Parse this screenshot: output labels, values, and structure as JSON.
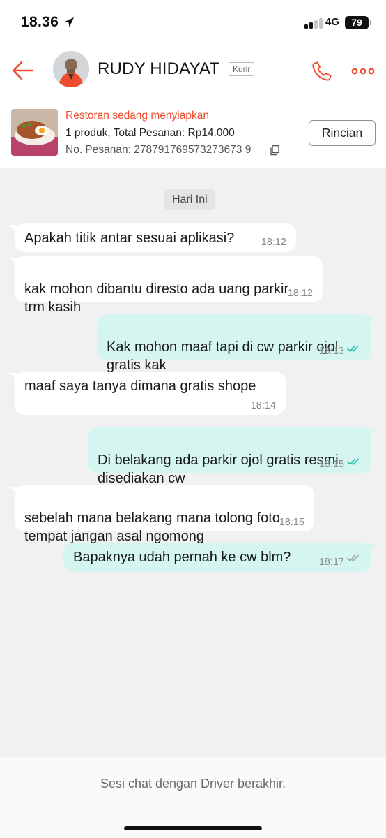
{
  "status_bar": {
    "time": "18.36",
    "network": "4G",
    "battery": "79"
  },
  "header": {
    "name": "RUDY HIDAYAT",
    "badge": "Kurir"
  },
  "order": {
    "status": "Restoran sedang menyiapkan",
    "summary": "1 produk, Total Pesanan: Rp14.000",
    "number": "No. Pesanan: 278791769573273673 9",
    "button": "Rincian"
  },
  "chat": {
    "date_label": "Hari Ini",
    "messages": [
      {
        "direction": "in",
        "text": "Apakah titik antar sesuai aplikasi?",
        "time": "18:12"
      },
      {
        "direction": "in",
        "text": "kak mohon dibantu diresto ada uang parkir\ntrm kasih",
        "time": "18:12"
      },
      {
        "direction": "out",
        "text": "Kak mohon maaf tapi di cw parkir ojol\ngratis kak",
        "time": "18:13"
      },
      {
        "direction": "in",
        "text": "maaf saya tanya dimana gratis shope",
        "time": "18:14"
      },
      {
        "direction": "out",
        "text": "Di belakang ada parkir ojol gratis resmi\ndisediakan cw",
        "time": "18:15"
      },
      {
        "direction": "in",
        "text": "sebelah mana belakang mana tolong foto\ntempat jangan asal ngomong",
        "time": "18:15"
      },
      {
        "direction": "out",
        "text": "Bapaknya udah pernah ke cw blm?",
        "time": "18:17"
      }
    ]
  },
  "footer": {
    "text": "Sesi chat dengan Driver berakhir."
  },
  "colors": {
    "accent": "#ee4d2d",
    "outgoing_bubble": "#d5f6f0",
    "incoming_bubble": "#ffffff",
    "chat_background": "#f1f1f1",
    "read_ticks": "#2bb5a4"
  },
  "icons": [
    "location-arrow-icon",
    "signal-icon",
    "back-arrow-icon",
    "phone-icon",
    "more-icon",
    "copy-icon",
    "double-check-icon"
  ]
}
